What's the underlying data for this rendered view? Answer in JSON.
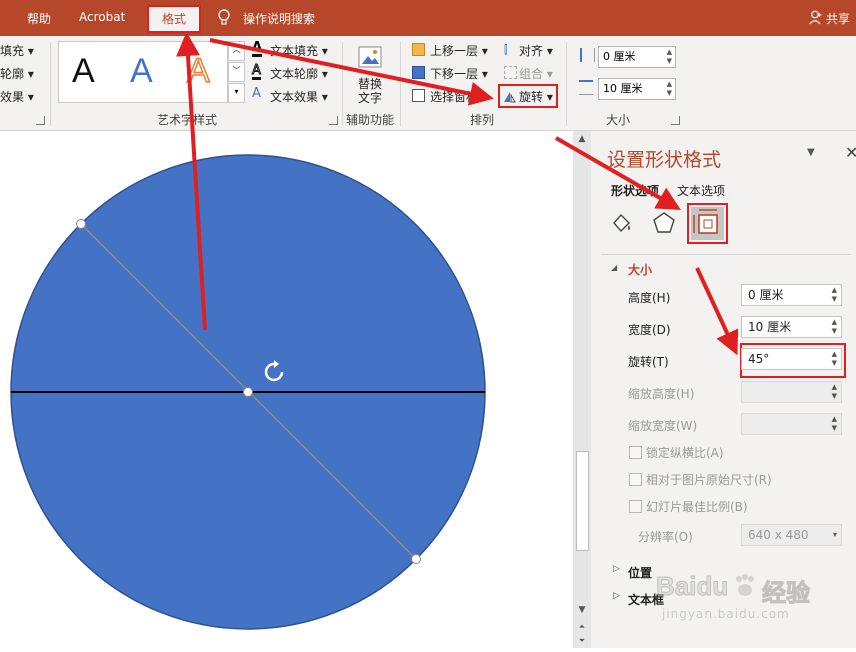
{
  "tabs": {
    "help": "帮助",
    "acrobat": "Acrobat",
    "format": "格式",
    "tell_me": "操作说明搜索",
    "share": "共享"
  },
  "ribbon": {
    "left_items": [
      "填充",
      "轮廓",
      "效果"
    ],
    "wordart": {
      "letter": "A",
      "text_fill": "文本填充",
      "text_outline": "文本轮廓",
      "text_effects": "文本效果",
      "group_label": "艺术字样式"
    },
    "accessibility": {
      "alt_text_line1": "替换",
      "alt_text_line2": "文字",
      "group_label": "辅助功能"
    },
    "arrange": {
      "bring_forward": "上移一层",
      "send_backward": "下移一层",
      "selection_pane": "选择窗格",
      "align": "对齐",
      "group": "组合",
      "rotate": "旋转",
      "group_label": "排列"
    },
    "size": {
      "height": "0 厘米",
      "width": "10 厘米",
      "group_label": "大小"
    }
  },
  "pane": {
    "title": "设置形状格式",
    "tab_shape": "形状选项",
    "tab_text": "文本选项",
    "section_size": "大小",
    "height_label": "高度(H)",
    "height_value": "0 厘米",
    "width_label": "宽度(D)",
    "width_value": "10 厘米",
    "rotation_label": "旋转(T)",
    "rotation_value": "45°",
    "scale_height_label": "缩放高度(H)",
    "scale_width_label": "缩放宽度(W)",
    "lock_aspect": "锁定纵横比(A)",
    "relative_original": "相对于图片原始尺寸(R)",
    "best_scale": "幻灯片最佳比例(B)",
    "resolution_label": "分辨率(O)",
    "resolution_value": "640 x 480",
    "section_position": "位置",
    "section_textbox": "文本框"
  },
  "watermark": {
    "brand": "Baidu",
    "brand_cn": "经验",
    "url": "jingyan.baidu.com"
  },
  "colors": {
    "accent": "#b7472a",
    "shape_fill": "#4472c4",
    "annotation": "#e02020"
  }
}
